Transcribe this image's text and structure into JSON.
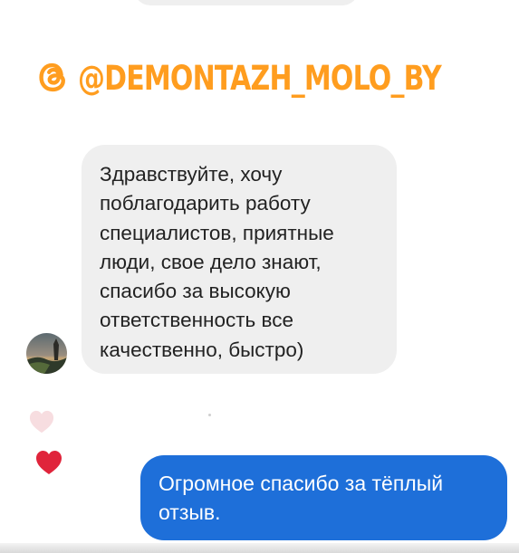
{
  "header": {
    "handle": "@DEMONTAZH_MOLO_BY",
    "handle_color": "#ff9d1f"
  },
  "conversation": {
    "incoming": {
      "avatar": "contact-avatar",
      "text": "Здравствуйте, хочу\nпоблагодарить работу\nспециалистов, приятные\nлюди, свое дело знают,\nспасибо за высокую\nответственность все\nкачественно, быстро)",
      "bubble_color": "#efefef"
    },
    "reactions": {
      "faded_icon": "heart-icon",
      "active_icon": "heart-icon",
      "active_color": "#e0243b"
    },
    "outgoing": {
      "text": "Огромное спасибо за тёплый\nотзыв.",
      "bubble_color": "#1e6fd9"
    }
  }
}
